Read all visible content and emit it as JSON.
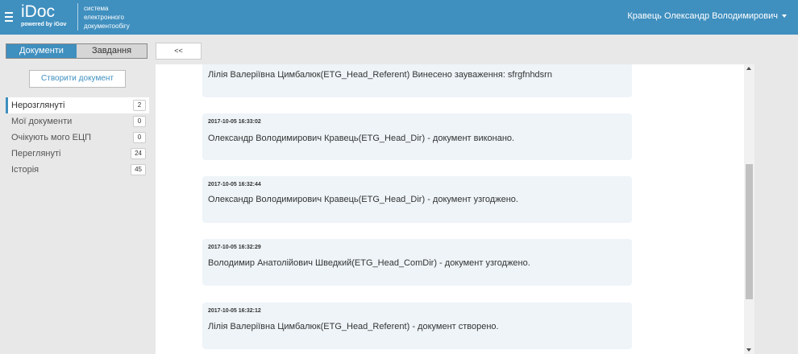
{
  "header": {
    "logo": "iDoc",
    "powered_by": "powered by iGov",
    "system_line1": "система",
    "system_line2": "електронного",
    "system_line3": "документообігу",
    "user_name": "Кравець Олександр Володимирович",
    "brand_color": "#3f8fbf"
  },
  "sidebar": {
    "tabs": [
      {
        "label": "Документи",
        "active": true
      },
      {
        "label": "Завдання",
        "active": false
      }
    ],
    "create_button": "Створити документ",
    "nav": [
      {
        "label": "Нерозглянуті",
        "count": "2",
        "active": true
      },
      {
        "label": "Мої документи",
        "count": "0"
      },
      {
        "label": "Очікують мого ЕЦП",
        "count": "0"
      },
      {
        "label": "Переглянуті",
        "count": "24"
      },
      {
        "label": "Історія",
        "count": "45"
      }
    ]
  },
  "collapse_button": "<<",
  "history": [
    {
      "date": "",
      "text": "Лілія Валеріївна Цимбалюк(ETG_Head_Referent) Винесено зауваження: sfrgfnhdsrn"
    },
    {
      "date": "2017-10-05 16:33:02",
      "text": "Олександр Володимирович Кравець(ETG_Head_Dir) - документ виконано."
    },
    {
      "date": "2017-10-05 16:32:44",
      "text": "Олександр Володимирович Кравець(ETG_Head_Dir) - документ узгоджено."
    },
    {
      "date": "2017-10-05 16:32:29",
      "text": "Володимир Анатолійович Шведкий(ETG_Head_ComDir) - документ узгоджено."
    },
    {
      "date": "2017-10-05 16:32:12",
      "text": "Лілія Валеріївна Цимбалюк(ETG_Head_Referent) - документ створено."
    }
  ]
}
